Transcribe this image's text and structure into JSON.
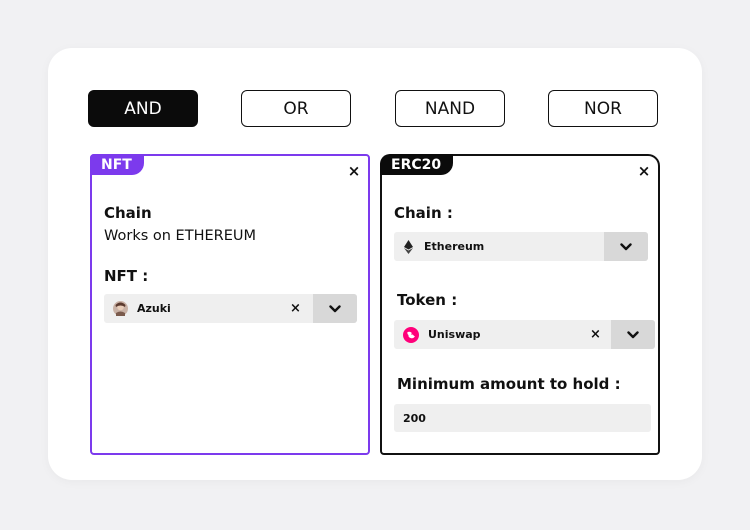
{
  "operators": [
    {
      "label": "AND",
      "active": true
    },
    {
      "label": "OR",
      "active": false
    },
    {
      "label": "NAND",
      "active": false
    },
    {
      "label": "NOR",
      "active": false
    }
  ],
  "nft_card": {
    "tag": "NFT",
    "close": "×",
    "chain_heading": "Chain",
    "chain_value": "Works on ETHEREUM",
    "nft_heading": "NFT :",
    "nft_select": {
      "value": "Azuki",
      "clear": "×",
      "icon": "azuki-avatar-icon"
    }
  },
  "erc_card": {
    "tag": "ERC20",
    "close": "×",
    "chain_heading": "Chain :",
    "chain_select": {
      "value": "Ethereum",
      "icon": "ethereum-icon"
    },
    "token_heading": "Token :",
    "token_select": {
      "value": "Uniswap",
      "clear": "×",
      "icon": "uniswap-icon"
    },
    "amount_heading": "Minimum amount to hold :",
    "amount_value": "200"
  },
  "colors": {
    "accent_purple": "#7c3aed",
    "uniswap_pink": "#ff007a",
    "dark": "#0b0b0b"
  }
}
